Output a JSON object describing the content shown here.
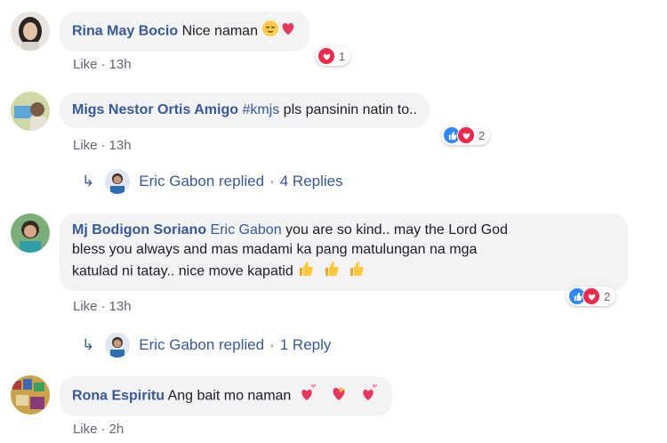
{
  "comments": [
    {
      "author": "Rina May Bocio",
      "text": "Nice naman",
      "like_label": "Like",
      "time": "13h",
      "reaction_count": "1"
    },
    {
      "author": "Migs Nestor Ortis Amigo",
      "tag": "#kmjs",
      "text": "pls pansinin natin to..",
      "like_label": "Like",
      "time": "13h",
      "reaction_count": "2",
      "replies": {
        "author": "Eric Gabon replied",
        "count": "4 Replies",
        "separator": "·"
      }
    },
    {
      "author": "Mj Bodigon Soriano",
      "mention": "Eric Gabon",
      "text_line1": "you are so kind.. may the Lord God",
      "text_line2": "bless you always and mas madami ka pang matulungan na mga",
      "text_line3": "katulad ni tatay.. nice move kapatid",
      "like_label": "Like",
      "time": "13h",
      "reaction_count": "2",
      "replies": {
        "author": "Eric Gabon replied",
        "count": "1 Reply",
        "separator": "·"
      }
    },
    {
      "author": "Rona Espiritu",
      "text": "Ang bait mo naman",
      "like_label": "Like",
      "time": "2h"
    }
  ],
  "separator": "·",
  "colors": {
    "link": "#385898",
    "bubble": "#f2f3f5",
    "meta": "#606770",
    "like": "#2d88ff",
    "love": "#f02849"
  }
}
